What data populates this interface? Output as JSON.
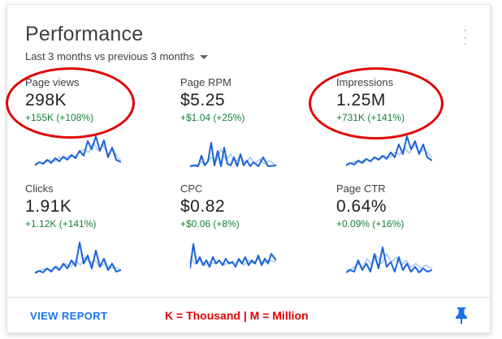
{
  "card": {
    "title": "Performance",
    "period": "Last 3 months vs previous 3 months"
  },
  "metrics": [
    {
      "label": "Page views",
      "value": "298K",
      "change": "+155K (+108%)"
    },
    {
      "label": "Page RPM",
      "value": "$5.25",
      "change": "+$1.04 (+25%)"
    },
    {
      "label": "Impressions",
      "value": "1.25M",
      "change": "+731K (+141%)"
    },
    {
      "label": "Clicks",
      "value": "1.91K",
      "change": "+1.12K (+141%)"
    },
    {
      "label": "CPC",
      "value": "$0.82",
      "change": "+$0.06 (+8%)"
    },
    {
      "label": "Page CTR",
      "value": "0.64%",
      "change": "+0.09% (+16%)"
    }
  ],
  "footer": {
    "view_report": "VIEW REPORT",
    "legend": "K = Thousand | M = Million"
  },
  "colors": {
    "accent": "#1a73e8",
    "positive_change": "#188038",
    "sparkline_current": "#1a63d8",
    "sparkline_previous": "#a9c4ef",
    "annotation": "#e00000"
  },
  "icons": {
    "menu": "more-vert-icon",
    "period_dropdown": "caret-down-icon",
    "pin": "pin-icon"
  }
}
